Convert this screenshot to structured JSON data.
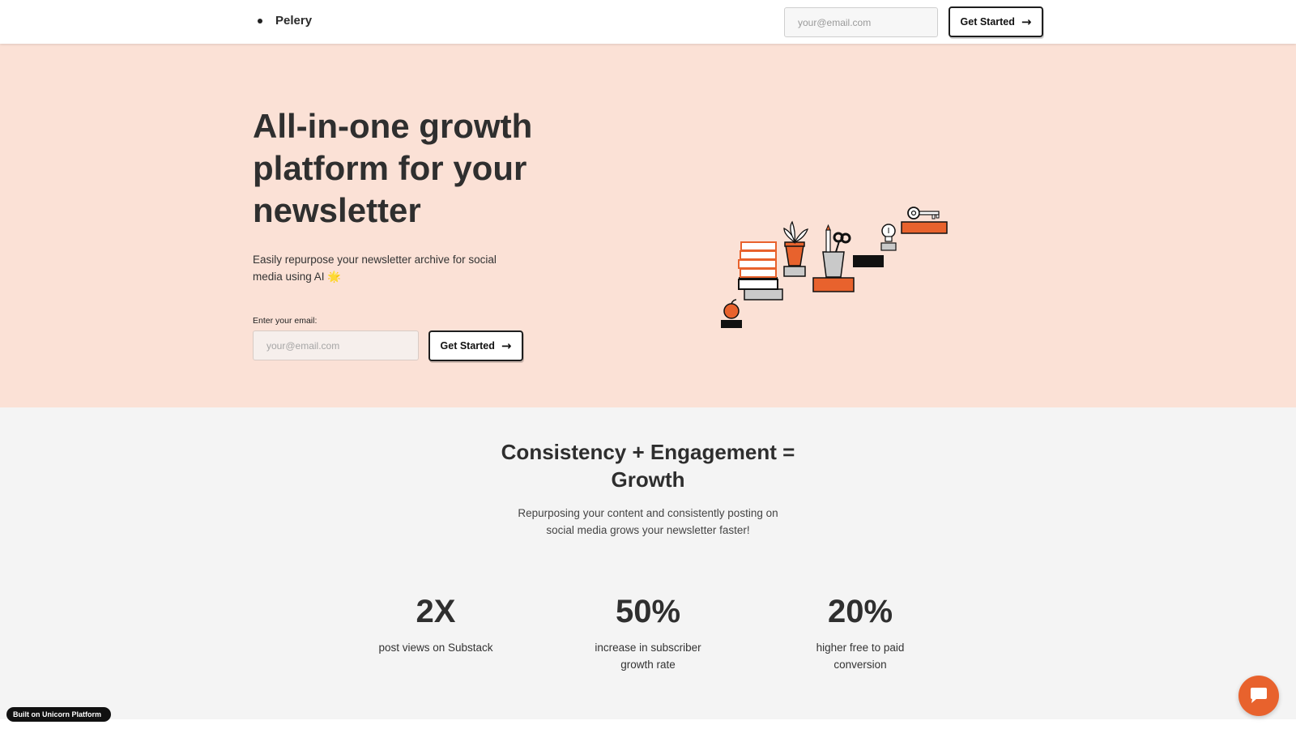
{
  "header": {
    "brand_name": "Pelery",
    "email_placeholder": "your@email.com",
    "cta_label": "Get Started"
  },
  "hero": {
    "title": "All-in-one growth platform for your newsletter",
    "subtitle": "Easily repurpose your newsletter archive for social media using AI 🌟",
    "email_label": "Enter your email:",
    "email_placeholder": "your@email.com",
    "cta_label": "Get Started"
  },
  "stats_section": {
    "title": "Consistency + Engagement = Growth",
    "subtitle": "Repurposing your content and consistently posting on social media grows your newsletter faster!",
    "items": [
      {
        "value": "2X",
        "label": "post views on Substack"
      },
      {
        "value": "50%",
        "label": "increase in subscriber growth rate"
      },
      {
        "value": "20%",
        "label": "higher free to paid conversion"
      }
    ]
  },
  "footer_badge": "Built on Unicorn Platform",
  "icons": {
    "arrow": "arrow-right-icon",
    "chat": "chat-bubble-icon",
    "illustration": "stairs-of-objects-illustration"
  },
  "colors": {
    "hero_bg": "#fbe1d6",
    "accent": "#e8622d",
    "section_bg": "#f4f4f4",
    "text": "#2e2e2e"
  }
}
